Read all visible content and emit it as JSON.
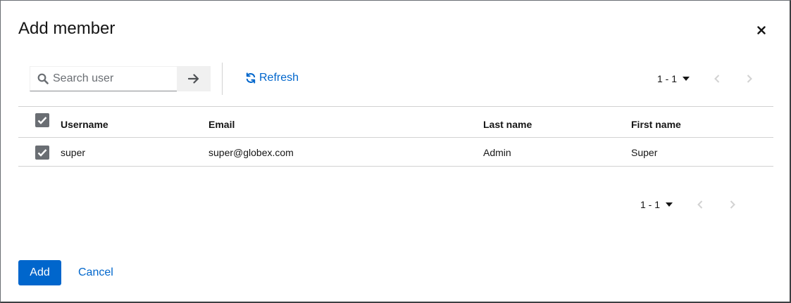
{
  "modal": {
    "title": "Add member",
    "close_icon": "close-icon"
  },
  "toolbar": {
    "search": {
      "placeholder": "Search user",
      "value": "",
      "go_icon": "arrow-right-icon",
      "icon": "search-icon"
    },
    "refresh_label": "Refresh",
    "refresh_icon": "sync-icon",
    "pagination": {
      "range_label": "1 - 1",
      "toggle_icon": "caret-down-icon",
      "prev_icon": "angle-left-icon",
      "next_icon": "angle-right-icon"
    }
  },
  "table": {
    "select_all_checked": true,
    "columns": [
      "Username",
      "Email",
      "Last name",
      "First name"
    ],
    "rows": [
      {
        "checked": true,
        "username": "super",
        "email": "super@globex.com",
        "last_name": "Admin",
        "first_name": "Super"
      }
    ]
  },
  "bottom_pagination": {
    "range_label": "1 - 1"
  },
  "footer": {
    "add_label": "Add",
    "cancel_label": "Cancel"
  },
  "colors": {
    "primary": "#0066cc",
    "checkbox": "#6a6e73",
    "border": "#d2d2d2",
    "text": "#151515",
    "disabled": "#d2d2d2"
  }
}
